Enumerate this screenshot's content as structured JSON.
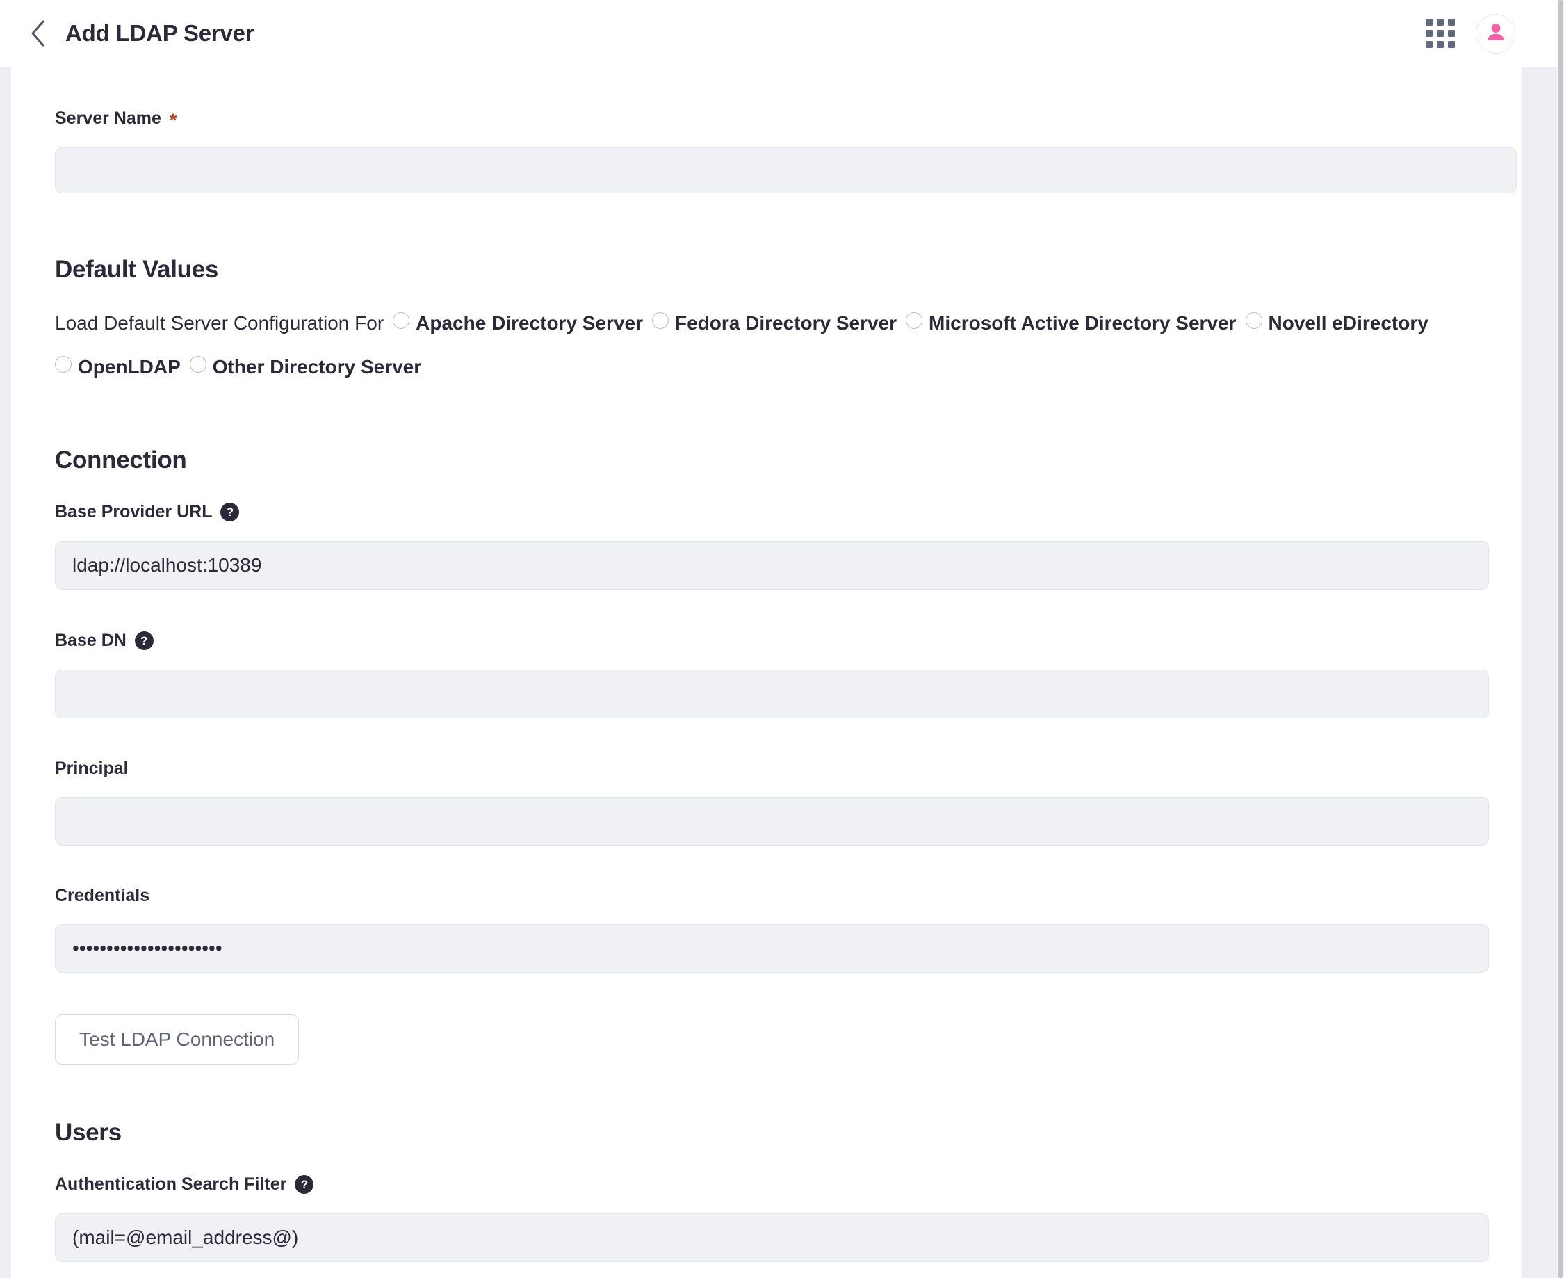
{
  "header": {
    "back_icon": "chevron-left-icon",
    "title": "Add LDAP Server",
    "grid_icon": "apps-grid-icon",
    "avatar_icon": "user-avatar-icon"
  },
  "form": {
    "server_name": {
      "label": "Server Name",
      "required_marker": "*",
      "value": "",
      "placeholder": ""
    },
    "default_values": {
      "section_title": "Default Values",
      "lead_text": "Load Default Server Configuration For",
      "options": [
        {
          "label": "Apache Directory Server",
          "selected": false
        },
        {
          "label": "Fedora Directory Server",
          "selected": false
        },
        {
          "label": "Microsoft Active Directory Server",
          "selected": false
        },
        {
          "label": "Novell eDirectory",
          "selected": false
        },
        {
          "label": "OpenLDAP",
          "selected": false
        },
        {
          "label": "Other Directory Server",
          "selected": false
        }
      ]
    },
    "connection": {
      "section_title": "Connection",
      "base_provider_url": {
        "label": "Base Provider URL",
        "help_icon": "help-circle-icon",
        "value": "ldap://localhost:10389",
        "placeholder": ""
      },
      "base_dn": {
        "label": "Base DN",
        "help_icon": "help-circle-icon",
        "value": "",
        "placeholder": ""
      },
      "principal": {
        "label": "Principal",
        "value": "",
        "placeholder": ""
      },
      "credentials": {
        "label": "Credentials",
        "value": "••••••••••••••••••••••",
        "placeholder": ""
      },
      "test_button_label": "Test LDAP Connection"
    },
    "users": {
      "section_title": "Users",
      "authentication_search_filter": {
        "label": "Authentication Search Filter",
        "help_icon": "help-circle-icon",
        "value": "(mail=@email_address@)",
        "placeholder": ""
      }
    }
  },
  "colors": {
    "text": "#2a2a38",
    "required": "#c1471c",
    "input_bg": "#eff1f5",
    "accent_pink": "#fb5fab",
    "gutter": "#eceef3",
    "button_text": "#5f6477"
  }
}
